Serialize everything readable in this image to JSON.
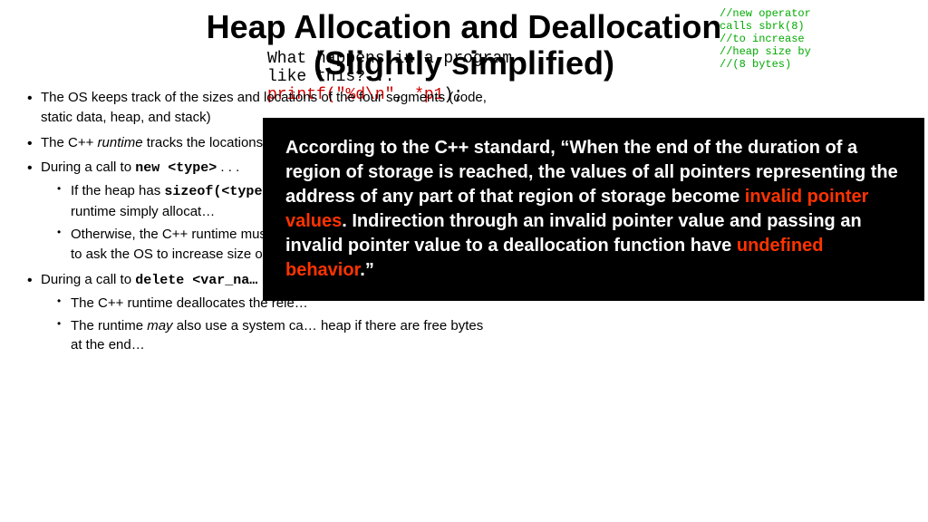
{
  "slide": {
    "title_line1": "Heap Allocation and Deallocation",
    "title_line2": "(Slightly simplified)",
    "body_items": [
      {
        "text": "The OS keeps track of the sizes and locations of the four segments (code, static data, heap, and stack)",
        "sub": []
      },
      {
        "text": "The C++ runtime tracks the locations of free space in the heap",
        "italic_part": "runtime",
        "sub": []
      },
      {
        "text": "During a call to new <type> . . .",
        "sub": [
          "If the heap has sizeof(<type>) or more free bytes, the C++ runtime simply allocates…",
          "Otherwise, the C++ runtime must first use a system call like sbrk() to ask the OS to increase size of the heap"
        ]
      },
      {
        "text": "During a call to delete <var_name> . . .",
        "sub": [
          "The C++ runtime deallocates the relevant bytes",
          "The runtime may also use a system call to shrink the heap if there are free bytes at the end…"
        ]
      }
    ],
    "code_behind": {
      "line1": "What happens in a program",
      "line2": "like this?...",
      "line3": "printf(\"%d\\n\",  *p1);"
    },
    "code_snippet": {
      "lines": [
        {
          "text": "//new operator",
          "color": "green"
        },
        {
          "text": "calls sbrk(8)",
          "color": "green"
        },
        {
          "text": "//to increase",
          "color": "green"
        },
        {
          "text": "//heap size by",
          "color": "green"
        },
        {
          "text": "//(8 bytes)",
          "color": "green"
        }
      ]
    },
    "overlay": {
      "text_before_red": "According to the  C++ standard, “When the end of the duration of a region of storage is reached, the values of all pointers representing the address of any part of that region of storage become ",
      "red_text1": "invalid pointer values",
      "text_middle": ".  Indirection through an invalid pointer value and passing an invalid pointer value to a deallocation function have ",
      "red_text2": "undefined behavior",
      "text_after": ".”"
    }
  }
}
